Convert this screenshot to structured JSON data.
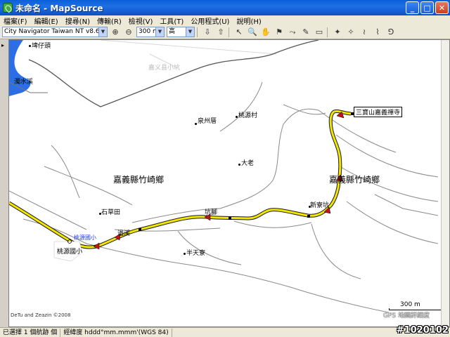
{
  "window": {
    "title": "未命名 - MapSource",
    "buttons": {
      "minimize": "_",
      "maximize": "□",
      "close": "✕"
    }
  },
  "menu": {
    "items": [
      "檔案(F)",
      "編輯(E)",
      "搜尋(N)",
      "傳輸(R)",
      "檢視(V)",
      "工具(T)",
      "公用程式(U)",
      "說明(H)"
    ]
  },
  "toolbar": {
    "map_product": "City Navigator Taiwan NT v8.6",
    "zoom_level": "300 m",
    "detail_level": "高"
  },
  "map": {
    "labels": {
      "place_top_left": "埤仔頭",
      "river": "濁水溪",
      "faint_road": "嘉义县小坑",
      "quanchuan": "泉州厝",
      "taoyuan_village": "桃源村",
      "temple": "三寶山嘉義禪寺",
      "dalao": "大老",
      "township_left": "嘉義縣竹崎鄉",
      "township_right": "嘉義縣竹崎鄉",
      "xinliao": "新寮坑",
      "shicaotian": "石草田",
      "kengjiao": "坑腳",
      "school_blue": "桃源國小",
      "school_callout": "桃源國小",
      "taiyuan": "過溪",
      "banliao": "半天寮"
    },
    "copyright": "DeTu and Zeazin ©2008",
    "scale": "300 m",
    "gps_text": "GPS 地圖詳細度"
  },
  "status": {
    "selection": "已選擇 1 個航跡 個",
    "coords": "經緯度 hddd°mm.mmm'(WGS 84)"
  },
  "watermark": "#1020102",
  "colors": {
    "track": "#f2e600",
    "track_outline": "#1a1a1a",
    "road": "#7a7a7a",
    "river": "#2b6ee6",
    "title_bar": "#0a5fd8"
  }
}
